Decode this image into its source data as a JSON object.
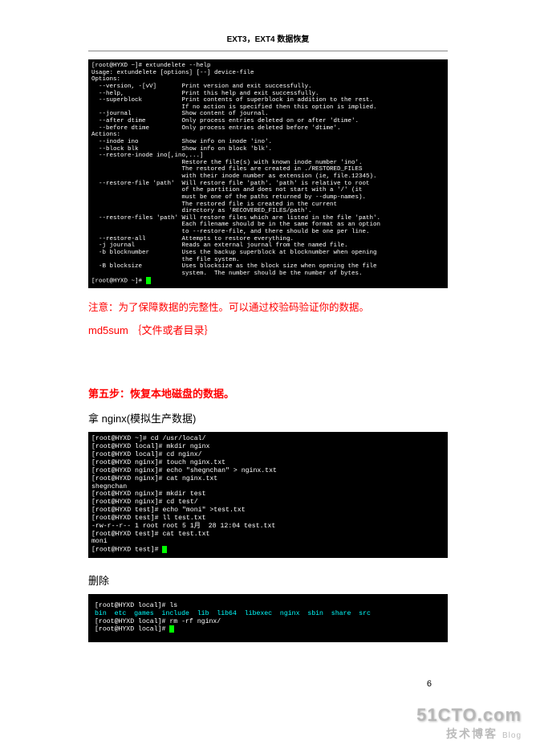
{
  "header": "EXT3，EXT4 数据恢复",
  "terminal1": "[root@HYXD ~]# extundelete --help\nUsage: extundelete [options] [--] device-file\nOptions:\n  --version, -[vV]       Print version and exit successfully.\n  --help,                Print this help and exit successfully.\n  --superblock           Print contents of superblock in addition to the rest.\n                         If no action is specified then this option is implied.\n  --journal              Show content of journal.\n  --after dtime          Only process entries deleted on or after 'dtime'.\n  --before dtime         Only process entries deleted before 'dtime'.\nActions:\n  --inode ino            Show info on inode 'ino'.\n  --block blk            Show info on block 'blk'.\n  --restore-inode ino[,ino,...]\n                         Restore the file(s) with known inode number 'ino'.\n                         The restored files are created in ./RESTORED_FILES\n                         with their inode number as extension (ie, file.12345).\n  --restore-file 'path'  Will restore file 'path'. 'path' is relative to root\n                         of the partition and does not start with a '/' (it\n                         must be one of the paths returned by --dump-names).\n                         The restored file is created in the current\n                         directory as 'RECOVERED_FILES/path'.\n  --restore-files 'path' Will restore files which are listed in the file 'path'.\n                         Each filename should be in the same format as an option\n                         to --restore-file, and there should be one per line.\n  --restore-all          Attempts to restore everything.\n  -j journal             Reads an external journal from the named file.\n  -b blocknumber         Uses the backup superblock at blocknumber when opening\n                         the file system.\n  -B blocksize           Uses blocksize as the block size when opening the file\n                         system.  The number should be the number of bytes.\n[root@HYXD ~]# ",
  "note1": "注意：为了保障数据的完整性。可以通过校验码验证你的数据。",
  "note2": "md5sum ｛文件或者目录｝",
  "step5": "第五步：恢复本地磁盘的数据。",
  "nginx_label": "拿 nginx(模拟生产数据)",
  "terminal2_prefix": "[root@HYXD ~]# cd /usr/local/\n[root@HYXD local]# mkdir nginx\n[root@HYXD local]# cd nginx/\n[root@HYXD nginx]# touch nginx.txt\n[root@HYXD nginx]# echo \"shegnchan\" > nginx.txt\n[root@HYXD nginx]# cat nginx.txt\nshegnchan\n[root@HYXD nginx]# mkdir test\n[root@HYXD nginx]# cd test/\n[root@HYXD test]# echo \"moni\" >test.txt\n[root@HYXD test]# ll test.txt\n-rw-r--r-- 1 root root 5 1月  28 12:04 test.txt\n[root@HYXD test]# cat test.txt\nmoni\n[root@HYXD test]# ",
  "delete_label": "删除",
  "terminal3_line1": "[root@HYXD local]# ls",
  "terminal3_line2_items": "bin  etc  games  include  lib  lib64  libexec  nginx  sbin  share  src",
  "terminal3_line3": "[root@HYXD local]# rm -rf nginx/\n[root@HYXD local]# ",
  "page_number": "6",
  "watermark": {
    "top": "51CTO.com",
    "cn": "技术博客",
    "blog": "Blog"
  }
}
